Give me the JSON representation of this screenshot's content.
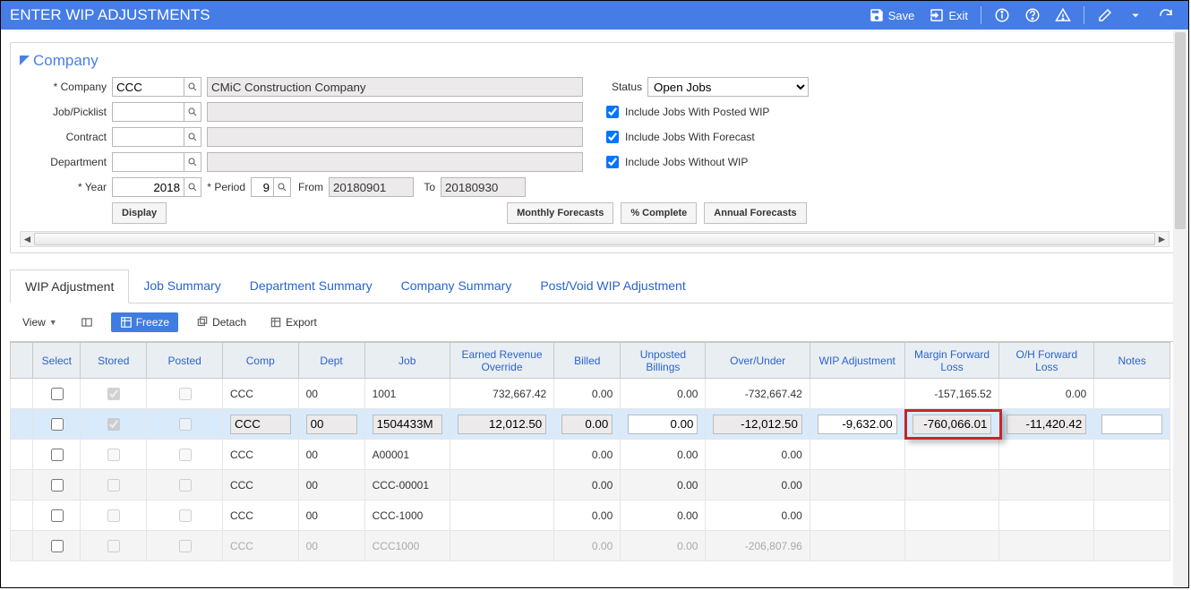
{
  "window": {
    "title": "ENTER WIP ADJUSTMENTS",
    "save": "Save",
    "exit": "Exit"
  },
  "panel": {
    "title": "Company",
    "labels": {
      "company": "Company",
      "jobpicklist": "Job/Picklist",
      "contract": "Contract",
      "department": "Department",
      "year": "Year",
      "period": "Period",
      "from": "From",
      "to": "To",
      "status": "Status"
    },
    "values": {
      "company_code": "CCC",
      "company_name": "CMiC Construction Company",
      "year": "2018",
      "period": "9",
      "from": "20180901",
      "to": "20180930",
      "status_selected": "Open Jobs"
    },
    "checks": {
      "posted_wip": "Include Jobs With Posted WIP",
      "forecast": "Include Jobs With Forecast",
      "without_wip": "Include Jobs Without WIP"
    },
    "buttons": {
      "display": "Display",
      "monthly": "Monthly Forecasts",
      "pct": "% Complete",
      "annual": "Annual Forecasts"
    }
  },
  "tabs": [
    "WIP Adjustment",
    "Job Summary",
    "Department Summary",
    "Company Summary",
    "Post/Void WIP Adjustment"
  ],
  "toolbar": {
    "view": "View",
    "freeze": "Freeze",
    "detach": "Detach",
    "export": "Export"
  },
  "grid": {
    "headers": [
      "Select",
      "Stored",
      "Posted",
      "Comp",
      "Dept",
      "Job",
      "Earned Revenue Override",
      "Billed",
      "Unposted Billings",
      "Over/Under",
      "WIP Adjustment",
      "Margin Forward Loss",
      "O/H Forward Loss",
      "Notes"
    ],
    "rows": [
      {
        "stored": true,
        "comp": "CCC",
        "dept": "00",
        "job": "1001",
        "ero": "732,667.42",
        "billed": "0.00",
        "unposted": "0.00",
        "ou": "-732,667.42",
        "wip": "",
        "mfl": "-157,165.52",
        "ofl": "0.00",
        "class": "odd"
      },
      {
        "stored": true,
        "comp": "CCC",
        "dept": "00",
        "job": "1504433M",
        "ero": "12,012.50",
        "billed": "0.00",
        "unposted": "0.00",
        "ou": "-12,012.50",
        "wip": "-9,632.00",
        "mfl": "-760,066.01",
        "ofl": "-11,420.42",
        "class": "selected",
        "editable": true
      },
      {
        "stored": false,
        "comp": "CCC",
        "dept": "00",
        "job": "A00001",
        "ero": "",
        "billed": "0.00",
        "unposted": "0.00",
        "ou": "0.00",
        "wip": "",
        "mfl": "",
        "ofl": "",
        "class": "odd"
      },
      {
        "stored": false,
        "comp": "CCC",
        "dept": "00",
        "job": "CCC-00001",
        "ero": "",
        "billed": "0.00",
        "unposted": "0.00",
        "ou": "0.00",
        "wip": "",
        "mfl": "",
        "ofl": "",
        "class": "even"
      },
      {
        "stored": false,
        "comp": "CCC",
        "dept": "00",
        "job": "CCC-1000",
        "ero": "",
        "billed": "0.00",
        "unposted": "0.00",
        "ou": "0.00",
        "wip": "",
        "mfl": "",
        "ofl": "",
        "class": "odd"
      },
      {
        "stored": false,
        "comp": "CCC",
        "dept": "00",
        "job": "CCC1000",
        "ero": "",
        "billed": "0.00",
        "unposted": "0.00",
        "ou": "-206,807.96",
        "wip": "",
        "mfl": "",
        "ofl": "",
        "class": "even last"
      }
    ]
  }
}
